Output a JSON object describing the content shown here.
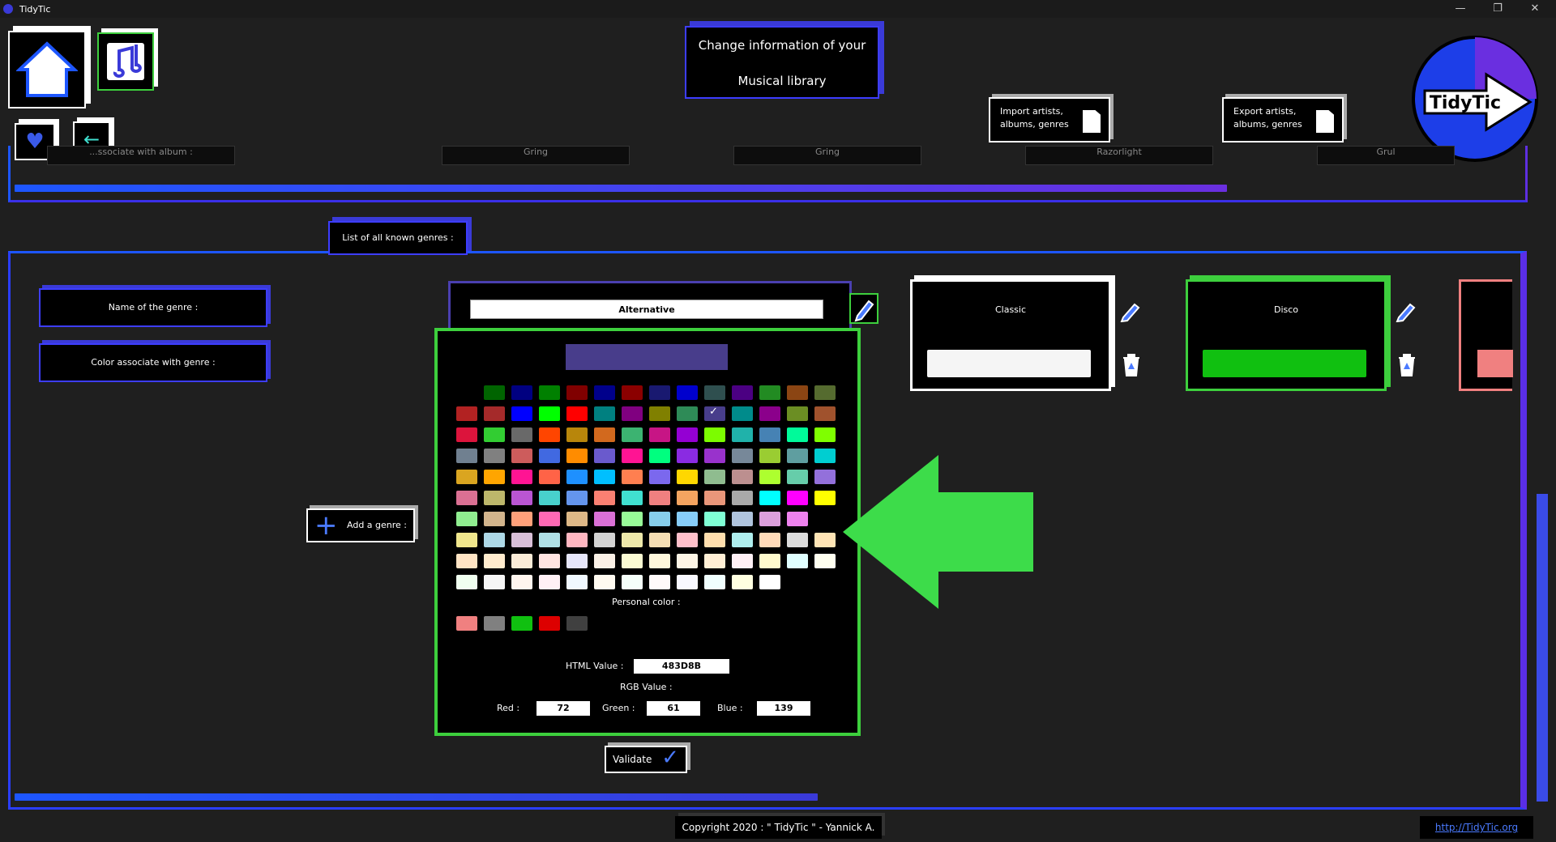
{
  "window": {
    "title": "TidyTic",
    "controls": {
      "minimize": "—",
      "maximize": "❐",
      "close": "✕"
    }
  },
  "header": {
    "title_line1": "Change information of your",
    "title_line2": "Musical library",
    "import_label_1": "Import artists,",
    "import_label_2": "albums, genres",
    "export_label_1": "Export artists,",
    "export_label_2": "albums, genres",
    "logo_text": "TidyTic"
  },
  "top_panel": {
    "ghost_items": [
      "...ssociate with album :",
      "Gring",
      "Gring",
      "Razorlight",
      "Grul"
    ],
    "progress_fraction": 0.8
  },
  "tab": {
    "label": "List of all known genres :"
  },
  "labels": {
    "name": "Name of the genre :",
    "color": "Color associate with genre :"
  },
  "add_genre": {
    "label": "Add a genre :"
  },
  "editor": {
    "genre_name": "Alternative",
    "preview_color": "#483D8B",
    "personal_label": "Personal color :",
    "personal_colors": [
      "#f08080",
      "#808080",
      "#10c010",
      "#dd0000",
      "#404040"
    ],
    "html_label": "HTML Value :",
    "html_value": "483D8B",
    "rgb_label": "RGB Value :",
    "red_label": "Red :",
    "red": "72",
    "green_label": "Green :",
    "green": "61",
    "blue_label": "Blue :",
    "blue": "139",
    "selected_index": [
      1,
      9
    ]
  },
  "palette": [
    [
      "",
      "#006400",
      "#000080",
      "#008000",
      "#800000",
      "#00008b",
      "#8b0000",
      "#191970",
      "#0000cd",
      "#2f4f4f",
      "#4b0082",
      "#228b22",
      "#8b4513",
      "#556b2f"
    ],
    [
      "#b22222",
      "#a52a2a",
      "#0000ff",
      "#00ff00",
      "#ff0000",
      "#008080",
      "#800080",
      "#808000",
      "#2e8b57",
      "#483d8b",
      "#008b8b",
      "#8b008b",
      "#6b8e23",
      "#a0522d"
    ],
    [
      "#dc143c",
      "#32cd32",
      "#696969",
      "#ff4500",
      "#b8860b",
      "#d2691e",
      "#3cb371",
      "#c71585",
      "#9400d3",
      "#7cfc00",
      "#20b2aa",
      "#4682b4",
      "#00fa9a",
      "#7fff00"
    ],
    [
      "#708090",
      "#808080",
      "#cd5c5c",
      "#4169e1",
      "#ff8c00",
      "#6a5acd",
      "#ff1493",
      "#00ff7f",
      "#8a2be2",
      "#9932cc",
      "#778899",
      "#9acd32",
      "#5f9ea0",
      "#00ced1"
    ],
    [
      "#daa520",
      "#ffa500",
      "#ff1493",
      "#ff6347",
      "#1e90ff",
      "#00bfff",
      "#ff7f50",
      "#7b68ee",
      "#ffd700",
      "#8fbc8f",
      "#bc8f8f",
      "#adff2f",
      "#66cdaa",
      "#9370db"
    ],
    [
      "#db7093",
      "#bdb76b",
      "#ba55d3",
      "#48d1cc",
      "#6495ed",
      "#fa8072",
      "#40e0d0",
      "#f08080",
      "#f4a460",
      "#e9967a",
      "#a9a9a9",
      "#00ffff",
      "#ff00ff",
      "#ffff00"
    ],
    [
      "#90ee90",
      "#d2b48c",
      "#ffa07a",
      "#ff69b4",
      "#deb887",
      "#da70d6",
      "#98fb98",
      "#87ceeb",
      "#87cefa",
      "#7fffd4",
      "#b0c4de",
      "#dda0dd",
      "#ee82ee",
      ""
    ],
    [
      "#f0e68c",
      "#add8e6",
      "#d8bfd8",
      "#b0e0e6",
      "#ffb6c1",
      "#d3d3d3",
      "#eee8aa",
      "#f5deb3",
      "#ffc0cb",
      "#ffdead",
      "#afeeee",
      "#ffdab9",
      "#dcdcdc",
      "#ffe4b5"
    ],
    [
      "#ffe4c4",
      "#ffebcd",
      "#faebd7",
      "#ffe4e1",
      "#e6e6fa",
      "#faf0e6",
      "#fafad2",
      "#fff8dc",
      "#fdf5e6",
      "#ffefd5",
      "#fff0f5",
      "#fffacd",
      "#e0ffff",
      "#fffff0"
    ],
    [
      "#f0fff0",
      "#f5f5f5",
      "#fff5ee",
      "#fff0f5",
      "#f0f8ff",
      "#fffaf0",
      "#f5fffa",
      "#fffafa",
      "#f8f8ff",
      "#f0ffff",
      "#ffffe0",
      "#ffffff"
    ]
  ],
  "genres": [
    {
      "name": "Classic",
      "color": "#f5f5f5"
    },
    {
      "name": "Disco",
      "color": "#10c010"
    }
  ],
  "validate": {
    "label": "Validate"
  },
  "footer": {
    "copyright": "Copyright 2020 : \" TidyTic \" - Yannick A.",
    "link": "http://TidyTic.org"
  },
  "bottom_progress_fraction": 0.53
}
